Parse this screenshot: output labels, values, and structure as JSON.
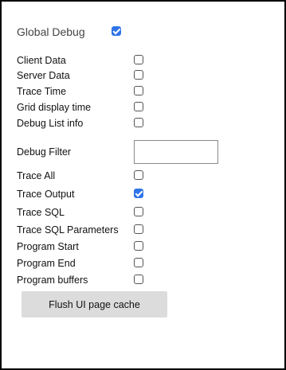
{
  "global_debug": {
    "label": "Global Debug",
    "checked": true
  },
  "options_group1": [
    {
      "label": "Client Data",
      "checked": false
    },
    {
      "label": "Server Data",
      "checked": false
    },
    {
      "label": "Trace Time",
      "checked": false
    },
    {
      "label": "Grid display time",
      "checked": false
    },
    {
      "label": "Debug List info",
      "checked": false
    }
  ],
  "debug_filter": {
    "label": "Debug Filter",
    "value": "",
    "placeholder": ""
  },
  "options_group2": [
    {
      "label": "Trace All",
      "checked": false
    },
    {
      "label": "Trace Output",
      "checked": true
    },
    {
      "label": "Trace SQL",
      "checked": false
    },
    {
      "label": "Trace SQL Parameters",
      "checked": false
    },
    {
      "label": "Program Start",
      "checked": false
    },
    {
      "label": "Program End",
      "checked": false
    },
    {
      "label": "Program buffers",
      "checked": false
    }
  ],
  "flush_button": {
    "label": "Flush UI page cache"
  },
  "colors": {
    "accent": "#2f74e8",
    "button_bg": "#dcdcdc",
    "border": "#000000"
  }
}
